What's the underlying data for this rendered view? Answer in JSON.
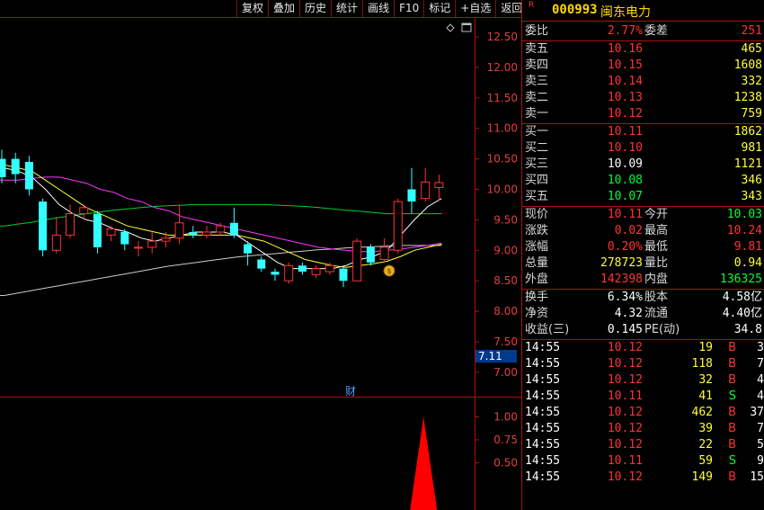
{
  "toolbar": {
    "buttons": [
      "复权",
      "叠加",
      "历史",
      "统计",
      "画线",
      "F10",
      "标记",
      "+自选",
      "返回"
    ]
  },
  "chart": {
    "price_axis_labels": [
      "12.50",
      "12.00",
      "11.50",
      "11.00",
      "10.50",
      "10.00",
      "9.50",
      "9.00",
      "8.50",
      "8.00",
      "7.50",
      "7.00"
    ],
    "price_marker": "7.11",
    "volume_axis_labels": [
      "1.00",
      "0.75",
      "0.50"
    ],
    "event_marker": "财",
    "colors": {
      "up": "#ff3333",
      "down": "#33ffff",
      "ma5": "#ffffff",
      "ma10": "#ffff33",
      "ma20": "#ff33ff",
      "ma60": "#00cc33",
      "ma120": "#cccccc",
      "axis": "#b01010"
    },
    "icons": {
      "collapse": "diamond-icon",
      "window": "window-icon",
      "money": "money-bag-icon"
    }
  },
  "chart_data": {
    "type": "candlestick",
    "ylim": [
      7.0,
      12.7
    ],
    "candles": [
      {
        "o": 10.5,
        "c": 10.2,
        "h": 10.65,
        "l": 10.1
      },
      {
        "o": 10.5,
        "c": 10.25,
        "h": 10.6,
        "l": 10.1
      },
      {
        "o": 10.45,
        "c": 10.0,
        "h": 10.55,
        "l": 9.9
      },
      {
        "o": 9.8,
        "c": 9.0,
        "h": 9.85,
        "l": 8.9
      },
      {
        "o": 9.0,
        "c": 9.25,
        "h": 9.55,
        "l": 8.95
      },
      {
        "o": 9.25,
        "c": 9.6,
        "h": 9.75,
        "l": 9.2
      },
      {
        "o": 9.6,
        "c": 9.7,
        "h": 9.75,
        "l": 9.5
      },
      {
        "o": 9.6,
        "c": 9.05,
        "h": 9.65,
        "l": 8.95
      },
      {
        "o": 9.25,
        "c": 9.35,
        "h": 9.4,
        "l": 9.15
      },
      {
        "o": 9.3,
        "c": 9.1,
        "h": 9.35,
        "l": 9.0
      },
      {
        "o": 9.05,
        "c": 9.05,
        "h": 9.15,
        "l": 8.9
      },
      {
        "o": 9.05,
        "c": 9.15,
        "h": 9.3,
        "l": 8.95
      },
      {
        "o": 9.15,
        "c": 9.2,
        "h": 9.3,
        "l": 9.05
      },
      {
        "o": 9.2,
        "c": 9.45,
        "h": 9.75,
        "l": 9.1
      },
      {
        "o": 9.3,
        "c": 9.25,
        "h": 9.4,
        "l": 9.2
      },
      {
        "o": 9.25,
        "c": 9.3,
        "h": 9.4,
        "l": 9.2
      },
      {
        "o": 9.3,
        "c": 9.4,
        "h": 9.45,
        "l": 9.25
      },
      {
        "o": 9.45,
        "c": 9.25,
        "h": 9.7,
        "l": 9.2
      },
      {
        "o": 9.1,
        "c": 8.95,
        "h": 9.15,
        "l": 8.75
      },
      {
        "o": 8.85,
        "c": 8.7,
        "h": 8.9,
        "l": 8.65
      },
      {
        "o": 8.65,
        "c": 8.6,
        "h": 8.7,
        "l": 8.5
      },
      {
        "o": 8.5,
        "c": 8.75,
        "h": 8.8,
        "l": 8.45
      },
      {
        "o": 8.75,
        "c": 8.65,
        "h": 8.8,
        "l": 8.6
      },
      {
        "o": 8.6,
        "c": 8.7,
        "h": 8.75,
        "l": 8.55
      },
      {
        "o": 8.65,
        "c": 8.75,
        "h": 8.8,
        "l": 8.6
      },
      {
        "o": 8.7,
        "c": 8.5,
        "h": 8.72,
        "l": 8.4
      },
      {
        "o": 8.5,
        "c": 9.15,
        "h": 9.2,
        "l": 8.5
      },
      {
        "o": 9.05,
        "c": 8.8,
        "h": 9.1,
        "l": 8.75
      },
      {
        "o": 8.85,
        "c": 9.05,
        "h": 9.2,
        "l": 8.8
      },
      {
        "o": 9.0,
        "c": 9.8,
        "h": 9.85,
        "l": 8.95
      },
      {
        "o": 10.0,
        "c": 9.8,
        "h": 10.35,
        "l": 9.6
      },
      {
        "o": 9.85,
        "c": 10.12,
        "h": 10.35,
        "l": 9.8
      },
      {
        "o": 10.03,
        "c": 10.11,
        "h": 10.24,
        "l": 9.81
      }
    ],
    "ma5": [
      10.35,
      10.3,
      10.2,
      10.0,
      9.75,
      9.6,
      9.5,
      9.45,
      9.35,
      9.3,
      9.2,
      9.15,
      9.2,
      9.25,
      9.3,
      9.3,
      9.3,
      9.25,
      9.1,
      8.95,
      8.8,
      8.7,
      8.7,
      8.7,
      8.7,
      8.75,
      8.85,
      8.9,
      9.0,
      9.25,
      9.5,
      9.72,
      9.85
    ],
    "ma10": [
      10.4,
      10.35,
      10.3,
      10.15,
      10.0,
      9.85,
      9.7,
      9.6,
      9.5,
      9.4,
      9.35,
      9.3,
      9.25,
      9.25,
      9.25,
      9.25,
      9.25,
      9.25,
      9.2,
      9.15,
      9.05,
      8.95,
      8.85,
      8.8,
      8.75,
      8.72,
      8.75,
      8.78,
      8.82,
      8.9,
      9.0,
      9.05,
      9.1
    ],
    "ma20": [
      10.15,
      10.15,
      10.18,
      10.2,
      10.2,
      10.15,
      10.1,
      10.0,
      9.95,
      9.85,
      9.8,
      9.7,
      9.65,
      9.55,
      9.5,
      9.45,
      9.4,
      9.35,
      9.3,
      9.25,
      9.2,
      9.15,
      9.1,
      9.05,
      9.02,
      9.0,
      8.98,
      8.98,
      9.0,
      9.02,
      9.05,
      9.08,
      9.12
    ],
    "ma60": [
      9.4,
      9.43,
      9.46,
      9.5,
      9.54,
      9.57,
      9.6,
      9.63,
      9.66,
      9.68,
      9.7,
      9.72,
      9.73,
      9.74,
      9.75,
      9.75,
      9.75,
      9.75,
      9.75,
      9.75,
      9.74,
      9.73,
      9.72,
      9.7,
      9.68,
      9.66,
      9.64,
      9.62,
      9.6,
      9.6,
      9.6,
      9.6,
      9.6
    ],
    "ma120": [
      8.26,
      8.3,
      8.34,
      8.38,
      8.42,
      8.46,
      8.5,
      8.54,
      8.58,
      8.62,
      8.66,
      8.7,
      8.74,
      8.77,
      8.8,
      8.83,
      8.86,
      8.89,
      8.91,
      8.93,
      8.95,
      8.97,
      8.99,
      9.01,
      9.02,
      9.04,
      9.05,
      9.06,
      9.07,
      9.08,
      9.08,
      9.08,
      9.08
    ],
    "volume_indicator": {
      "ylim": [
        0.25,
        1.05
      ],
      "peak_value": 1.0,
      "peak_index": 31
    }
  },
  "header": {
    "badge": "R",
    "code": "000993",
    "name": "闽东电力"
  },
  "quote": {
    "weibi": {
      "label": "委比",
      "value": "2.77%",
      "label2": "委差",
      "value2": "251"
    },
    "asks": [
      {
        "label": "卖五",
        "price": "10.16",
        "vol": "465"
      },
      {
        "label": "卖四",
        "price": "10.15",
        "vol": "1608"
      },
      {
        "label": "卖三",
        "price": "10.14",
        "vol": "332"
      },
      {
        "label": "卖二",
        "price": "10.13",
        "vol": "1238"
      },
      {
        "label": "卖一",
        "price": "10.12",
        "vol": "759"
      }
    ],
    "bids": [
      {
        "label": "买一",
        "price": "10.11",
        "vol": "1862"
      },
      {
        "label": "买二",
        "price": "10.10",
        "vol": "981"
      },
      {
        "label": "买三",
        "price": "10.09",
        "vol": "1121"
      },
      {
        "label": "买四",
        "price": "10.08",
        "vol": "346"
      },
      {
        "label": "买五",
        "price": "10.07",
        "vol": "343"
      }
    ],
    "stats1": [
      {
        "l1": "现价",
        "v1": "10.11",
        "l2": "今开",
        "v2": "10.03"
      },
      {
        "l1": "涨跌",
        "v1": "0.02",
        "l2": "最高",
        "v2": "10.24"
      },
      {
        "l1": "涨幅",
        "v1": "0.20%",
        "l2": "最低",
        "v2": "9.81"
      },
      {
        "l1": "总量",
        "v1": "278723",
        "l2": "量比",
        "v2": "0.94"
      },
      {
        "l1": "外盘",
        "v1": "142398",
        "l2": "内盘",
        "v2": "136325"
      }
    ],
    "stats2": [
      {
        "l1": "换手",
        "v1": "6.34%",
        "l2": "股本",
        "v2": "4.58亿"
      },
      {
        "l1": "净资",
        "v1": "4.32",
        "l2": "流通",
        "v2": "4.40亿"
      },
      {
        "l1": "收益(三)",
        "v1": "0.145",
        "l2": "PE(动)",
        "v2": "34.8"
      }
    ]
  },
  "ticks": [
    {
      "time": "14:55",
      "price": "10.12",
      "vol": "19",
      "side": "B",
      "count": "3"
    },
    {
      "time": "14:55",
      "price": "10.12",
      "vol": "118",
      "side": "B",
      "count": "7"
    },
    {
      "time": "14:55",
      "price": "10.12",
      "vol": "32",
      "side": "B",
      "count": "4"
    },
    {
      "time": "14:55",
      "price": "10.11",
      "vol": "41",
      "side": "S",
      "count": "4"
    },
    {
      "time": "14:55",
      "price": "10.12",
      "vol": "462",
      "side": "B",
      "count": "37"
    },
    {
      "time": "14:55",
      "price": "10.12",
      "vol": "39",
      "side": "B",
      "count": "7"
    },
    {
      "time": "14:55",
      "price": "10.12",
      "vol": "22",
      "side": "B",
      "count": "5"
    },
    {
      "time": "14:55",
      "price": "10.11",
      "vol": "59",
      "side": "S",
      "count": "9"
    },
    {
      "time": "14:55",
      "price": "10.12",
      "vol": "149",
      "side": "B",
      "count": "15"
    }
  ]
}
